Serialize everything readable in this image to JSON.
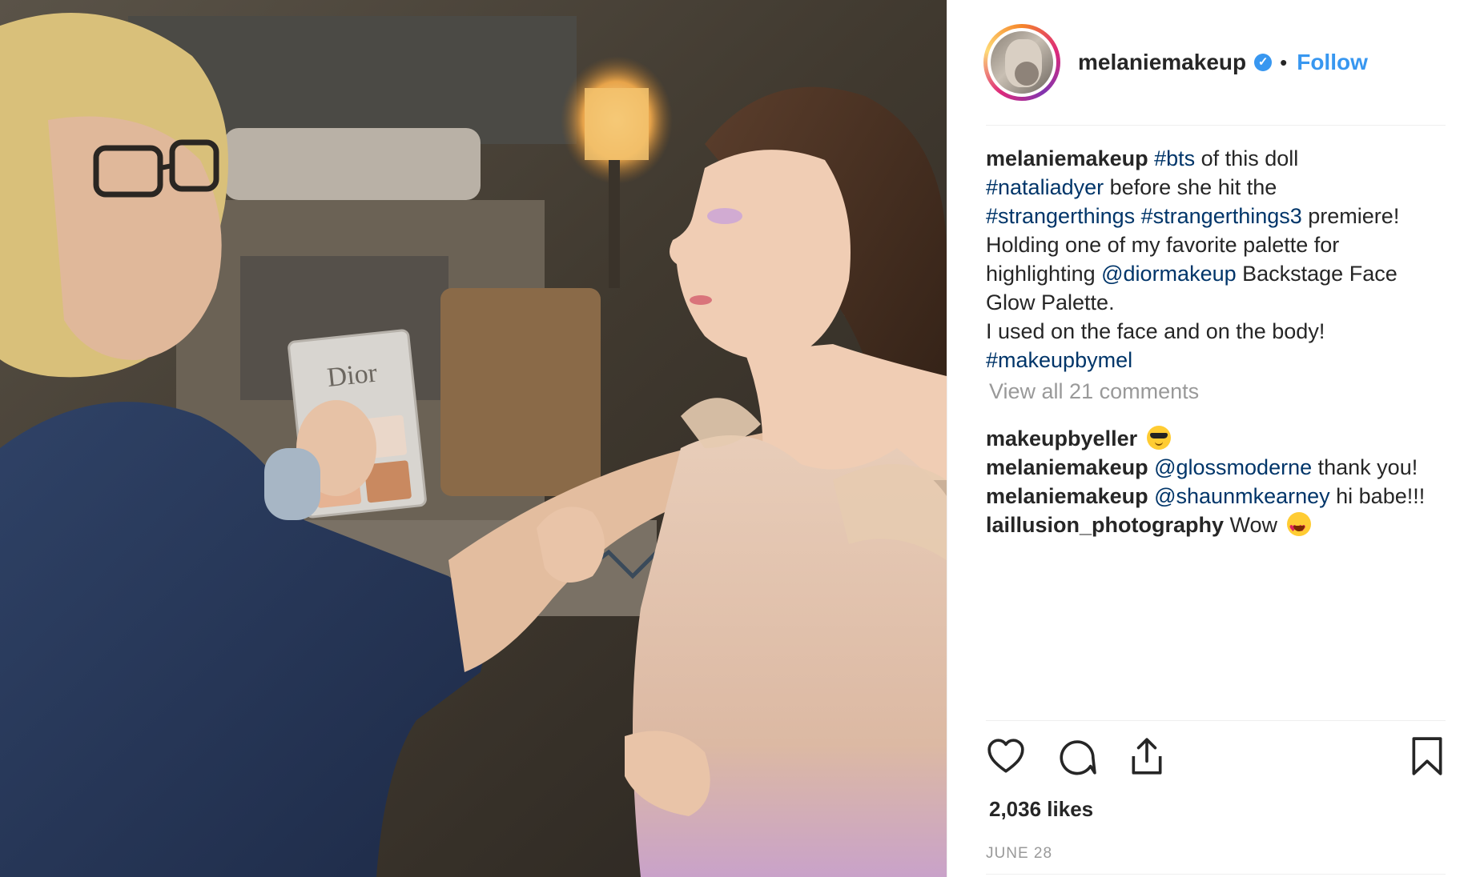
{
  "post": {
    "username": "melaniemakeup",
    "verified_symbol": "✓",
    "dot": "•",
    "follow_label": "Follow",
    "photo_alt": "",
    "photo_text": {
      "palette_brand": "Dior"
    }
  },
  "caption": {
    "username": "melaniemakeup",
    "segments": [
      {
        "text": "#bts",
        "type": "tag"
      },
      {
        "text": " of this doll ",
        "type": "text"
      },
      {
        "text": "#nataliadyer",
        "type": "tag"
      },
      {
        "text": " before she hit the ",
        "type": "text"
      },
      {
        "text": "#strangerthings",
        "type": "tag"
      },
      {
        "text": " ",
        "type": "text"
      },
      {
        "text": "#strangerthings3",
        "type": "tag"
      },
      {
        "text": " premiere!",
        "type": "text"
      },
      {
        "text": "Holding one of my favorite palette for highlighting ",
        "type": "text"
      },
      {
        "text": "@diormakeup",
        "type": "tag"
      },
      {
        "text": " Backstage Face Glow Palette.",
        "type": "text"
      },
      {
        "text": "I used on the face and on the body!",
        "type": "text"
      },
      {
        "text": "#makeupbymel",
        "type": "tag"
      }
    ]
  },
  "view_all_comments": "View all 21 comments",
  "comments": [
    {
      "username": "makeupbyeller",
      "parts": [],
      "emoji": "sunglasses"
    },
    {
      "username": "melaniemakeup",
      "parts": [
        {
          "text": "@glossmoderne",
          "type": "tag"
        },
        {
          "text": " thank you!",
          "type": "text"
        }
      ],
      "emoji": ""
    },
    {
      "username": "melaniemakeup",
      "parts": [
        {
          "text": "@shaunmkearney",
          "type": "tag"
        },
        {
          "text": " hi babe!!!",
          "type": "text"
        }
      ],
      "emoji": ""
    },
    {
      "username": "laillusion_photography",
      "parts": [
        {
          "text": " Wow",
          "type": "text"
        }
      ],
      "emoji": "heart-eyes"
    }
  ],
  "actions": {
    "like_icon": "heart-icon",
    "comment_icon": "comment-bubble-icon",
    "share_icon": "share-icon",
    "save_icon": "bookmark-icon"
  },
  "likes": "2,036 likes",
  "date": "JUNE 28",
  "colors": {
    "link": "#003569",
    "follow": "#3897f0",
    "muted": "#999999",
    "text": "#262626"
  }
}
